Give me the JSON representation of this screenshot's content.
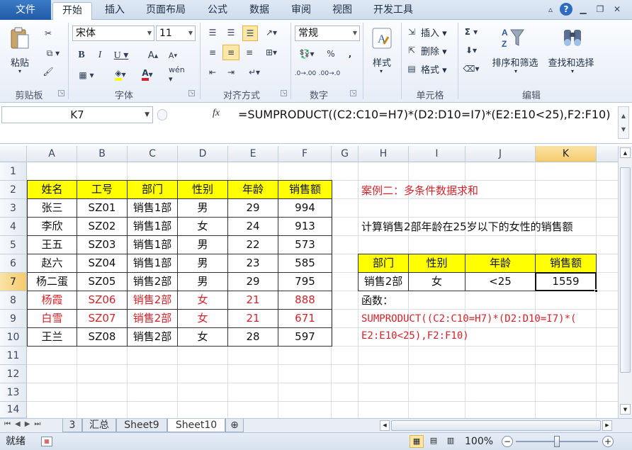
{
  "tabs": {
    "file": "文件",
    "home": "开始",
    "insert": "插入",
    "page_layout": "页面布局",
    "formulas": "公式",
    "data": "数据",
    "review": "审阅",
    "view": "视图",
    "developer": "开发工具"
  },
  "ribbon": {
    "clipboard": {
      "paste": "粘贴",
      "label": "剪贴板"
    },
    "font": {
      "name": "宋体",
      "size": "11",
      "label": "字体"
    },
    "alignment": {
      "label": "对齐方式"
    },
    "number": {
      "format": "常规",
      "label": "数字"
    },
    "styles": {
      "button": "样式"
    },
    "cells": {
      "insert": "插入",
      "delete": "删除",
      "format": "格式",
      "label": "单元格"
    },
    "editing": {
      "sort_filter": "排序和筛选",
      "find_select": "查找和选择",
      "label": "编辑"
    }
  },
  "formula_bar": {
    "name_box": "K7",
    "fx": "fx",
    "formula": "=SUMPRODUCT((C2:C10=H7)*(D2:D10=I7)*(E2:E10<25),F2:F10)"
  },
  "columns": [
    "A",
    "B",
    "C",
    "D",
    "E",
    "F",
    "G",
    "H",
    "I",
    "J",
    "K"
  ],
  "rows": [
    "1",
    "2",
    "3",
    "4",
    "5",
    "6",
    "7",
    "8",
    "9",
    "10",
    "11",
    "12",
    "13",
    "14"
  ],
  "table": {
    "header": [
      "姓名",
      "工号",
      "部门",
      "性别",
      "年龄",
      "销售额"
    ],
    "rows": [
      [
        "张三",
        "SZ01",
        "销售1部",
        "男",
        "29",
        "994"
      ],
      [
        "李欣",
        "SZ02",
        "销售1部",
        "女",
        "24",
        "913"
      ],
      [
        "王五",
        "SZ03",
        "销售1部",
        "男",
        "22",
        "573"
      ],
      [
        "赵六",
        "SZ04",
        "销售1部",
        "男",
        "23",
        "585"
      ],
      [
        "杨二蛋",
        "SZ05",
        "销售2部",
        "男",
        "29",
        "795"
      ],
      [
        "杨霞",
        "SZ06",
        "销售2部",
        "女",
        "21",
        "888"
      ],
      [
        "白雪",
        "SZ07",
        "销售2部",
        "女",
        "21",
        "671"
      ],
      [
        "王兰",
        "SZ08",
        "销售2部",
        "女",
        "28",
        "597"
      ]
    ],
    "highlight_color": "#d2232a",
    "header_fill": "#ffff00"
  },
  "case": {
    "title": "案例二：多条件数据求和",
    "description": "计算销售2部年龄在25岁以下的女性的销售额",
    "criteria_header": [
      "部门",
      "性别",
      "年龄",
      "销售额"
    ],
    "criteria_values": [
      "销售2部",
      "女",
      "<25",
      "1559"
    ],
    "func_label": "函数：",
    "func_line1": "SUMPRODUCT((C2:C10=H7)*(D2:D10=I7)*(",
    "func_line2": "E2:E10<25),F2:F10)"
  },
  "sheets": [
    "3",
    "汇总",
    "Sheet9",
    "Sheet10"
  ],
  "status": {
    "ready": "就绪",
    "zoom": "100%"
  }
}
